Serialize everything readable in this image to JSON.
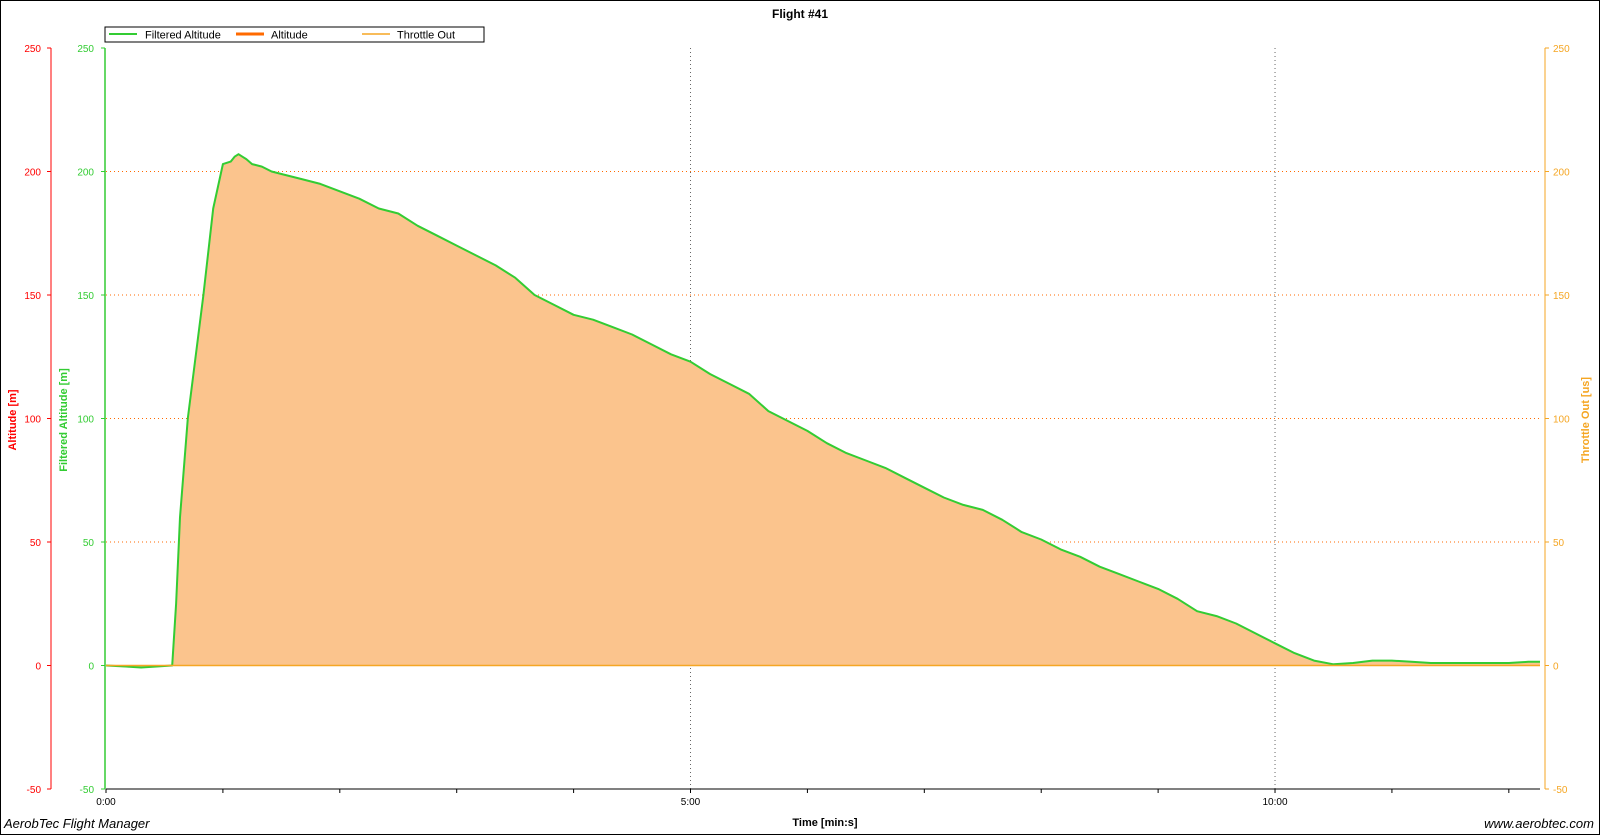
{
  "chart_data": {
    "type": "area",
    "title": "Flight #41",
    "xlabel": "Time [min:s]",
    "x_ticks": [
      "0:00",
      "5:00",
      "10:00"
    ],
    "xlim_seconds": [
      0,
      736
    ],
    "axes": {
      "altitude": {
        "label": "Altitude [m]",
        "color": "#ff0000",
        "ylim": [
          -50,
          250
        ],
        "ticks": [
          "-50",
          "0",
          "50",
          "100",
          "150",
          "200",
          "250"
        ]
      },
      "filtered": {
        "label": "Filtered Altitude [m]",
        "color": "#33cc33",
        "ylim": [
          -50,
          250
        ],
        "ticks": [
          "-50",
          "0",
          "50",
          "100",
          "150",
          "200",
          "250"
        ]
      },
      "throttle": {
        "label": "Throttle Out [us]",
        "color": "#f5a623",
        "ylim": [
          -50,
          250
        ],
        "ticks": [
          "-50",
          "0",
          "50",
          "100",
          "150",
          "200",
          "250"
        ]
      }
    },
    "legend": {
      "position": "top-left",
      "items": [
        {
          "name": "Filtered Altitude",
          "color": "#33cc33"
        },
        {
          "name": "Altitude",
          "color": "#ff6a00"
        },
        {
          "name": "Throttle Out",
          "color": "#f5a623"
        }
      ]
    },
    "grid": "dotted",
    "fill_color": "#fbc48d",
    "series": [
      {
        "name": "Filtered Altitude",
        "x": [
          "0:00",
          "0:12",
          "0:18",
          "0:34",
          "0:36",
          "0:38",
          "0:42",
          "0:50",
          "0:55",
          "1:00",
          "1:04",
          "1:06",
          "1:08",
          "1:10",
          "1:12",
          "1:15",
          "1:20",
          "1:25",
          "1:30",
          "1:40",
          "1:50",
          "2:00",
          "2:10",
          "2:20",
          "2:30",
          "2:40",
          "2:50",
          "3:00",
          "3:10",
          "3:20",
          "3:30",
          "3:40",
          "3:50",
          "4:00",
          "4:10",
          "4:20",
          "4:30",
          "4:40",
          "4:50",
          "5:00",
          "5:10",
          "5:20",
          "5:30",
          "5:40",
          "5:50",
          "6:00",
          "6:10",
          "6:20",
          "6:30",
          "6:40",
          "6:50",
          "7:00",
          "7:10",
          "7:20",
          "7:30",
          "7:40",
          "7:50",
          "8:00",
          "8:10",
          "8:20",
          "8:30",
          "8:40",
          "8:50",
          "9:00",
          "9:10",
          "9:20",
          "9:30",
          "9:40",
          "9:50",
          "10:00",
          "10:10",
          "10:20",
          "10:30",
          "10:40",
          "10:50",
          "11:00",
          "11:10",
          "11:20",
          "11:30",
          "11:40",
          "11:45",
          "11:50",
          "11:55",
          "12:00",
          "12:10",
          "12:16"
        ],
        "values": [
          0,
          -0.5,
          -0.8,
          0,
          25,
          60,
          100,
          150,
          185,
          203,
          204,
          206,
          207,
          206,
          205,
          203,
          202,
          200,
          199,
          197,
          195,
          192,
          189,
          185,
          183,
          178,
          174,
          170,
          166,
          162,
          157,
          150,
          146,
          142,
          140,
          137,
          134,
          130,
          126,
          123,
          118,
          114,
          110,
          103,
          99,
          95,
          90,
          86,
          83,
          80,
          76,
          72,
          68,
          65,
          63,
          59,
          54,
          51,
          47,
          44,
          40,
          37,
          34,
          31,
          27,
          22,
          20,
          17,
          13,
          9,
          5,
          2,
          0.5,
          1,
          2,
          2,
          1.5,
          1,
          1,
          1,
          1,
          1,
          1,
          1,
          1.5,
          1.5
        ]
      },
      {
        "name": "Throttle Out",
        "x": [
          "0:00",
          "12:16"
        ],
        "values": [
          0,
          0
        ]
      }
    ]
  },
  "footer": {
    "left": "AerobTec Flight Manager",
    "right": "www.aerobtec.com"
  }
}
